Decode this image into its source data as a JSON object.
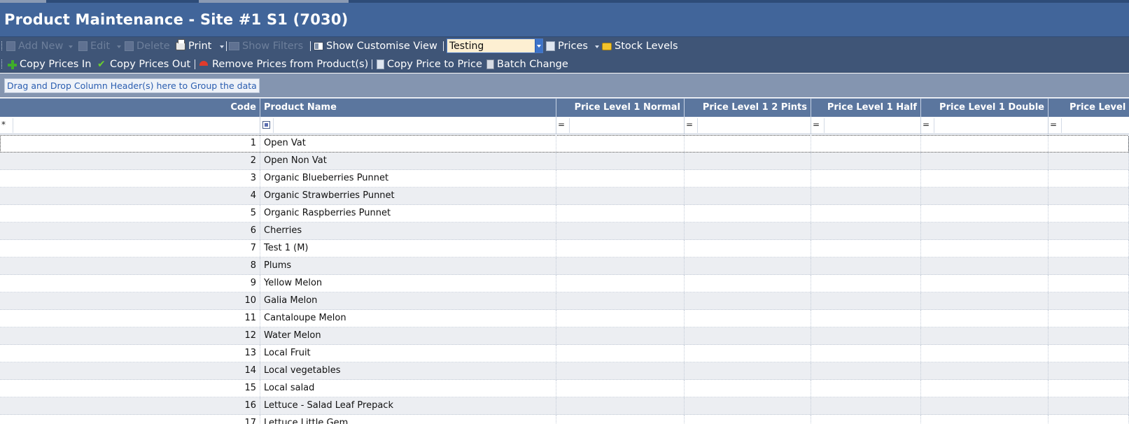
{
  "title": "Product Maintenance - Site #1 S1 (7030)",
  "toolbar1": {
    "add_new": "Add New",
    "edit": "Edit",
    "delete": "Delete",
    "print": "Print",
    "show_filters": "Show Filters",
    "show_customise_view": "Show Customise View",
    "view_select": "Testing",
    "prices": "Prices",
    "stock_levels": "Stock Levels"
  },
  "toolbar2": {
    "copy_prices_in": "Copy Prices In",
    "copy_prices_out": "Copy Prices Out",
    "remove_prices": "Remove Prices from Product(s)",
    "copy_price_to_price": "Copy Price to Price",
    "batch_change": "Batch Change"
  },
  "group_panel": {
    "hint": "Drag and Drop Column Header(s) here to Group the data"
  },
  "columns": [
    "Code",
    "Product Name",
    "Price Level 1 Normal",
    "Price Level 1 2 Pints",
    "Price Level 1 Half",
    "Price Level 1 Double",
    "Price Level"
  ],
  "filter_row": {
    "marker": "*",
    "operators": [
      "=",
      "=",
      "=",
      "=",
      "="
    ]
  },
  "rows": [
    {
      "code": "1",
      "name": "Open Vat"
    },
    {
      "code": "2",
      "name": "Open Non Vat"
    },
    {
      "code": "3",
      "name": "Organic Blueberries Punnet"
    },
    {
      "code": "4",
      "name": "Organic Strawberries Punnet"
    },
    {
      "code": "5",
      "name": "Organic Raspberries Punnet"
    },
    {
      "code": "6",
      "name": "Cherries"
    },
    {
      "code": "7",
      "name": "Test 1 (M)"
    },
    {
      "code": "8",
      "name": "Plums"
    },
    {
      "code": "9",
      "name": "Yellow Melon"
    },
    {
      "code": "10",
      "name": "Galia Melon"
    },
    {
      "code": "11",
      "name": "Cantaloupe Melon"
    },
    {
      "code": "12",
      "name": "Water Melon"
    },
    {
      "code": "13",
      "name": "Local Fruit"
    },
    {
      "code": "14",
      "name": "Local vegetables"
    },
    {
      "code": "15",
      "name": "Local salad"
    },
    {
      "code": "16",
      "name": "Lettuce - Salad Leaf Prepack"
    },
    {
      "code": "17",
      "name": "Lettuce Little Gem"
    }
  ]
}
